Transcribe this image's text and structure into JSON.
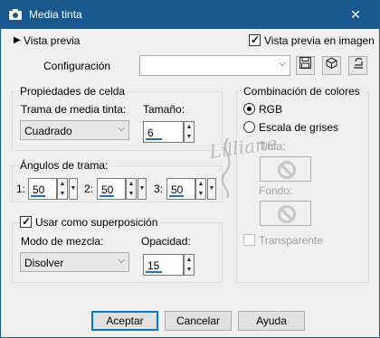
{
  "window": {
    "title": "Media tinta",
    "close_symbol": "✕"
  },
  "preview": {
    "toggle_label": "Vista previa",
    "show_in_image_label": "Vista previa en imagen",
    "show_in_image_checked": true
  },
  "config": {
    "label": "Configuración",
    "value": ""
  },
  "cell": {
    "group_label": "Propiedades de celda",
    "pattern_label": "Trama de media tinta:",
    "pattern_value": "Cuadrado",
    "size_label": "Tamaño:",
    "size_value": "6"
  },
  "angles": {
    "group_label": "Ángulos de trama:",
    "items": [
      {
        "label": "1:",
        "value": "50"
      },
      {
        "label": "2:",
        "value": "50"
      },
      {
        "label": "3:",
        "value": "50"
      }
    ]
  },
  "overlay": {
    "use_label": "Usar como superposición",
    "use_checked": true,
    "blend_label": "Modo de mezcla:",
    "blend_value": "Disolver",
    "opacity_label": "Opacidad:",
    "opacity_value": "15"
  },
  "colors": {
    "group_label": "Combinación de colores",
    "rgb_label": "RGB",
    "gray_label": "Escala de grises",
    "selected": "RGB",
    "ink_label": "Tinta:",
    "background_label": "Fondo:",
    "transparent_label": "Transparente"
  },
  "watermark": {
    "text": "Lilliane"
  },
  "buttons": {
    "ok": "Aceptar",
    "cancel": "Cancelar",
    "help": "Ayuda"
  },
  "colors_theme": {
    "titlebar": "#185a8f",
    "accent": "#0078d7",
    "dialog_bg": "#f0f0f0"
  }
}
